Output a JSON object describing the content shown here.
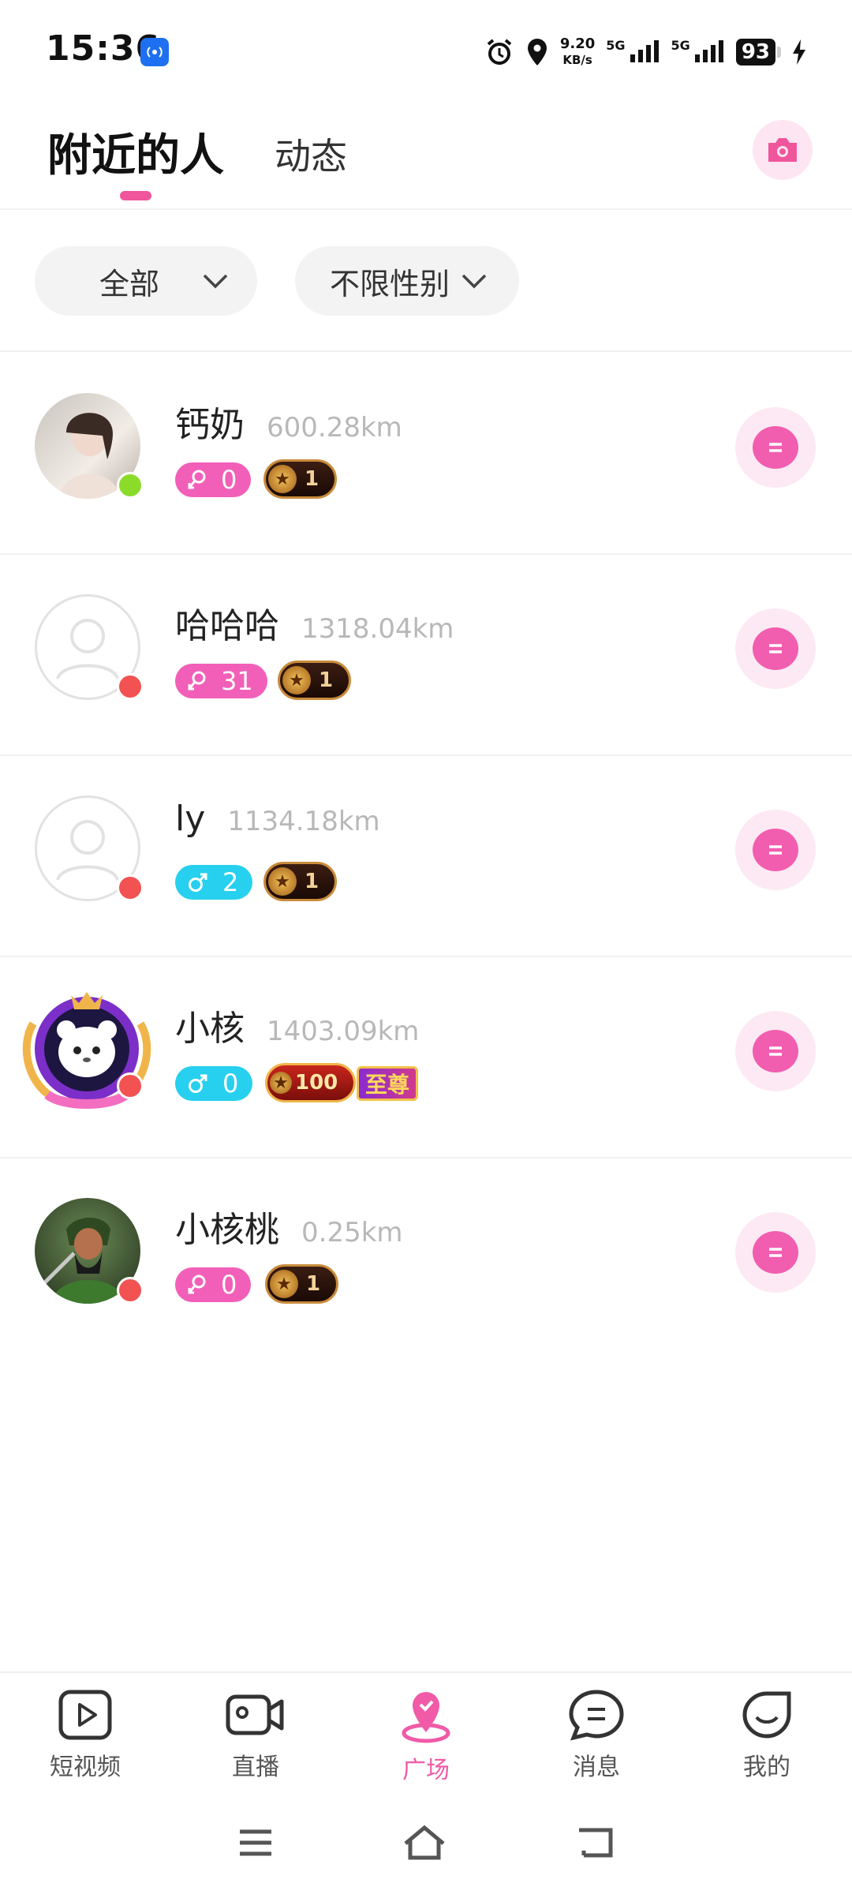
{
  "status_bar": {
    "time": "15:36",
    "net_speed_value": "9.20",
    "net_speed_unit": "KB/s",
    "sim1": "5G",
    "sim2": "5G",
    "battery": "93",
    "icons": [
      "screen-cast-icon",
      "alarm-icon",
      "location-icon",
      "signal-icon",
      "signal-icon",
      "battery-icon",
      "charging-icon"
    ]
  },
  "header": {
    "tab_nearby": "附近的人",
    "tab_moments": "动态",
    "active_tab": "附近的人",
    "camera_icon": "camera-icon"
  },
  "filters": {
    "scope": "全部",
    "gender": "不限性别"
  },
  "users": [
    {
      "name": "钙奶",
      "distance": "600.28km",
      "gender": "female",
      "gender_count": "0",
      "level": "1",
      "online": true,
      "avatar": "photo"
    },
    {
      "name": "哈哈哈",
      "distance": "1318.04km",
      "gender": "female",
      "gender_count": "31",
      "level": "1",
      "online": false,
      "avatar": "default"
    },
    {
      "name": "ly",
      "distance": "1134.18km",
      "gender": "male",
      "gender_count": "2",
      "level": "1",
      "online": false,
      "avatar": "default"
    },
    {
      "name": "小核",
      "distance": "1403.09km",
      "gender": "male",
      "gender_count": "0",
      "level": "100",
      "vip": "至尊",
      "online": false,
      "avatar": "bear"
    },
    {
      "name": "小核桃",
      "distance": "0.25km",
      "gender": "female",
      "gender_count": "0",
      "level": "1",
      "online": false,
      "avatar": "photo-warrior"
    }
  ],
  "colors": {
    "accent": "#f0569c",
    "female": "#f25fb8",
    "male": "#27d0ee",
    "online": "#8bdc2a",
    "offline": "#f25252"
  },
  "bottom_nav": {
    "items": [
      {
        "label": "短视频",
        "icon": "short-video-icon"
      },
      {
        "label": "直播",
        "icon": "live-camera-icon"
      },
      {
        "label": "广场",
        "icon": "square-location-icon"
      },
      {
        "label": "消息",
        "icon": "message-icon"
      },
      {
        "label": "我的",
        "icon": "profile-icon"
      }
    ],
    "active": "广场"
  },
  "system_nav": [
    "menu-icon",
    "home-icon",
    "back-icon"
  ]
}
